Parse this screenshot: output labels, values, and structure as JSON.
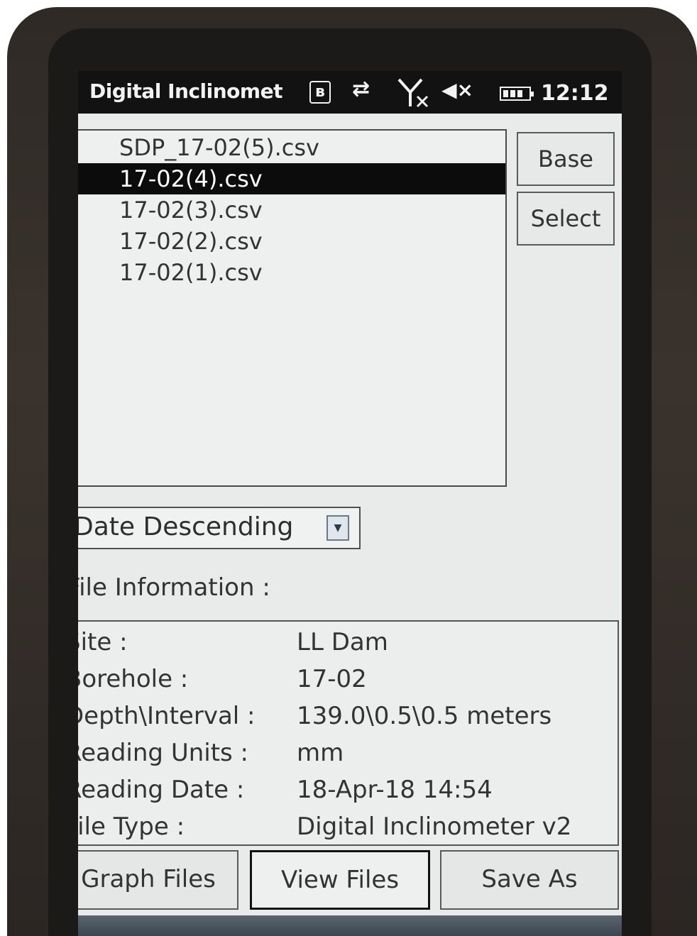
{
  "status_bar": {
    "app_title": "Digital Inclinomet",
    "time": "12:12",
    "icons": [
      "bluetooth-icon",
      "sync-icon",
      "no-signal-icon",
      "volume-muted-icon",
      "battery-icon"
    ],
    "bluetooth_glyph": "ʙ",
    "sync_glyph": "⇄",
    "volume_glyph": "◀×"
  },
  "file_list": {
    "items": [
      "SDP_17-02(5).csv",
      "17-02(4).csv",
      "17-02(3).csv",
      "17-02(2).csv",
      "17-02(1).csv"
    ],
    "selected_index": 1
  },
  "side_buttons": {
    "base_label": "Base",
    "select_label": "Select"
  },
  "sort": {
    "value": "Date Descending",
    "arrow_glyph": "▼"
  },
  "file_info": {
    "heading": "File Information :",
    "rows": [
      {
        "label": "Site :",
        "value": "LL Dam"
      },
      {
        "label": "Borehole :",
        "value": "17-02"
      },
      {
        "label": "Depth\\Interval :",
        "value": "139.0\\0.5\\0.5 meters"
      },
      {
        "label": "Reading Units :",
        "value": "mm"
      },
      {
        "label": "Reading Date :",
        "value": "18-Apr-18 14:54"
      },
      {
        "label": "File Type :",
        "value": "Digital Inclinometer v2"
      }
    ]
  },
  "bottom_buttons": {
    "graph_label": "Graph Files",
    "view_label": "View Files",
    "saveas_label": "Save As"
  }
}
